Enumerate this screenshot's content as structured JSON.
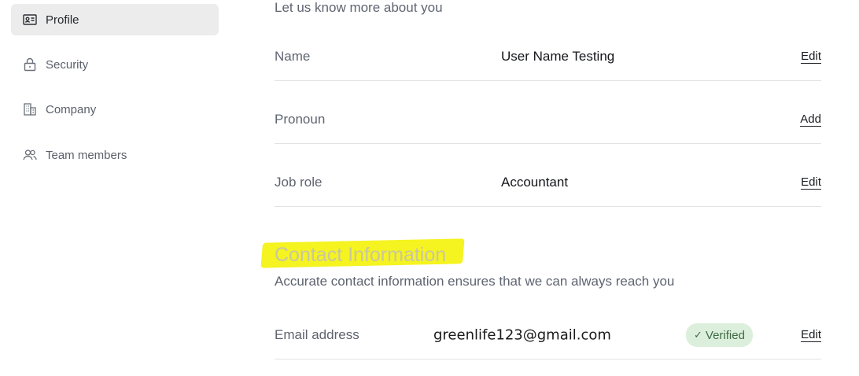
{
  "sidebar": {
    "items": [
      {
        "label": "Profile",
        "icon": "id-card-icon",
        "active": true
      },
      {
        "label": "Security",
        "icon": "lock-icon",
        "active": false
      },
      {
        "label": "Company",
        "icon": "building-icon",
        "active": false
      },
      {
        "label": "Team members",
        "icon": "users-icon",
        "active": false
      }
    ]
  },
  "about": {
    "intro": "Let us know more about you",
    "rows": [
      {
        "label": "Name",
        "value": "User Name Testing",
        "action": "Edit"
      },
      {
        "label": "Pronoun",
        "value": "",
        "action": "Add"
      },
      {
        "label": "Job role",
        "value": "Accountant",
        "action": "Edit"
      }
    ]
  },
  "contact": {
    "title": "Contact Information",
    "subtitle": "Accurate contact information ensures that we can always reach you",
    "email": {
      "label": "Email address",
      "value": "greenlife123@gmail.com",
      "badge": "Verified",
      "action": "Edit"
    }
  },
  "colors": {
    "highlight": "#f5f320",
    "active_nav_bg": "#ececec",
    "verified_bg": "#dcefdc",
    "verified_text": "#3e6a45"
  }
}
